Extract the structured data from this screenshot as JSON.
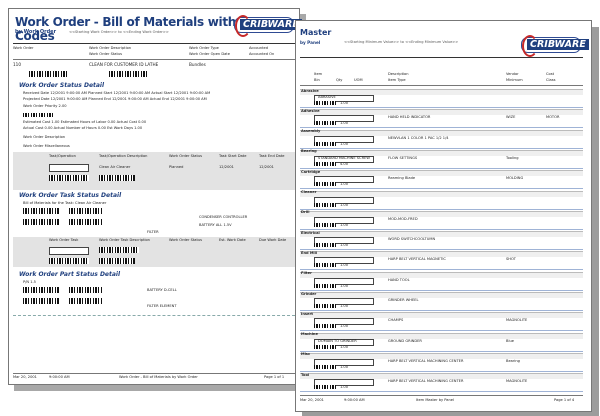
{
  "back": {
    "title": "Work Order - Bill of Materials with Bar Codes",
    "subtitle": "by Work Order",
    "filter_text": "<<Starting Work Order>> to <<Ending Work Order>>",
    "logo": "CRIBWARE",
    "header_cols": [
      "Work Order",
      "Work Order Description",
      "Work Order Type",
      "Accounted"
    ],
    "header_cols2": [
      "",
      "Work Order Status",
      "Work Order Open Date",
      "Accounted On"
    ],
    "wo_row": [
      "110",
      "CLEAN FOR CUSTOMER ID LATHE",
      "Bundles"
    ],
    "sections": {
      "status": "Work Order Status Detail",
      "task": "Work Order Task Status Detail",
      "parts": "Work Order Part Status Detail"
    },
    "status_lines": [
      "Received Date    12/2001  9:00:00 AM      Planned Start     12/2001  9:00:00 AM      Actual Start      12/2001  9:00:00 AM",
      "Projected Date   12/2001  9:00:00 AM      Planned End       12/2001  9:00:00 AM      Actual End        12/2001  9:00:00 AM",
      "Work Order Priority  2.00",
      "Estimated Cost   1.00      Estimated Hours of Labor   0.00      Actual Cost   0.00",
      "Actual Cost      0.00      Actual Number of Hours     0.00      Est Work Days  1.00",
      "Work Order Description",
      "Work Order Miscellaneous"
    ],
    "task_header": [
      "Task/Operation",
      "Task/Operation Description",
      "Work Order Status",
      "Task Start Date",
      "Task End Date"
    ],
    "task_row": [
      "Clean Air Cleaner",
      "Planned",
      "12/2001",
      "12/2001"
    ],
    "task_sub": "Bill of Materials for the Task: Clean Air Cleaner",
    "task_items": [
      "CONDENSER CONTROLLER",
      "BATTERY ALL 1.5V",
      "FILTER"
    ],
    "part_header": [
      "Work Order Task",
      "Work Order Task Description",
      "Work Order Status",
      "Est. Work Date",
      "Due Work Date"
    ],
    "part_rows": [
      "P/N 1.5",
      "BATTERY D-CELL",
      "FILTER ELEMENT"
    ],
    "footer": [
      "Mar 20, 2001",
      "9:00:00 AM",
      "Work Order - Bill of Materials by Work Order",
      "Page 1 of 1"
    ]
  },
  "front": {
    "title": "Master",
    "subtitle": "by Panel",
    "filter_text": "<<Starting Minimum Value>> to <<Ending Minimum Value>>",
    "logo": "CRIBWARE",
    "col_headers": [
      "Item",
      "Description",
      "Vendor",
      "Cost"
    ],
    "col_headers2": [
      "Bin",
      "Qty",
      "UOM",
      "Item Type",
      "Minimum",
      "Class"
    ],
    "rows": [
      {
        "cat": "Abrasive",
        "item": "ABRASIVE",
        "desc": "",
        "vendor": "",
        "cost": ""
      },
      {
        "cat": "Adhesive",
        "item": "",
        "desc": "HAND HELD INDICATOR",
        "vendor": "WIZE",
        "cost": "MOTOR"
      },
      {
        "cat": "Assembly",
        "item": "",
        "desc": "NEWVLAN 1 COLOR 1 PAC 1/2 1/4",
        "vendor": "",
        "cost": ""
      },
      {
        "cat": "Bearing",
        "item": "STANDARD MACHINE SCREW",
        "desc": "FLOW SETTINGS",
        "vendor": "Tooling",
        "cost": ""
      },
      {
        "cat": "Cartridge",
        "item": "",
        "desc": "Reaming Blade",
        "vendor": "MOLDING",
        "cost": ""
      },
      {
        "cat": "Cleaner",
        "item": "",
        "desc": "",
        "vendor": "",
        "cost": ""
      },
      {
        "cat": "Drill",
        "item": "",
        "desc": "MOD-MOD-FRED",
        "vendor": "",
        "cost": ""
      },
      {
        "cat": "Electrical",
        "item": "",
        "desc": "WORD SWITCHCOOLTUMN",
        "vendor": "",
        "cost": ""
      },
      {
        "cat": "End Mill",
        "item": "",
        "desc": "HARP BELT VERTICAL MAGNETIC",
        "vendor": "SHOT",
        "cost": ""
      },
      {
        "cat": "Filter",
        "item": "",
        "desc": "HAND TOOL",
        "vendor": "",
        "cost": ""
      },
      {
        "cat": "Grinder",
        "item": "",
        "desc": "GRINDER WHEEL",
        "vendor": "",
        "cost": ""
      },
      {
        "cat": "Insert",
        "item": "",
        "desc": "CHAMPS",
        "vendor": "MAGNOLITE",
        "cost": ""
      },
      {
        "cat": "Machine",
        "item": "DOMAIN TO GRINDER",
        "desc": "GROUND GRINDER",
        "vendor": "Blue",
        "cost": ""
      },
      {
        "cat": "Misc",
        "item": "",
        "desc": "HARP BELT VERTICAL MACHINING CENTER",
        "vendor": "Bearing",
        "cost": ""
      },
      {
        "cat": "Tool",
        "item": "",
        "desc": "HARP BELT VERTICAL MACHINING CENTER",
        "vendor": "MAGNOLITE",
        "cost": ""
      }
    ],
    "uom_values": [
      "1.00",
      "1.00",
      "1.00",
      "4.00",
      "1.00",
      "1.00",
      "1.00",
      "1.00",
      "1.00",
      "1.00",
      "1.00",
      "1.00",
      "1.00",
      "1.00",
      "1.00"
    ],
    "footer": [
      "Mar 20, 2001",
      "9:00:00 AM",
      "Item Master by Panel",
      "Page 1 of 4"
    ]
  }
}
